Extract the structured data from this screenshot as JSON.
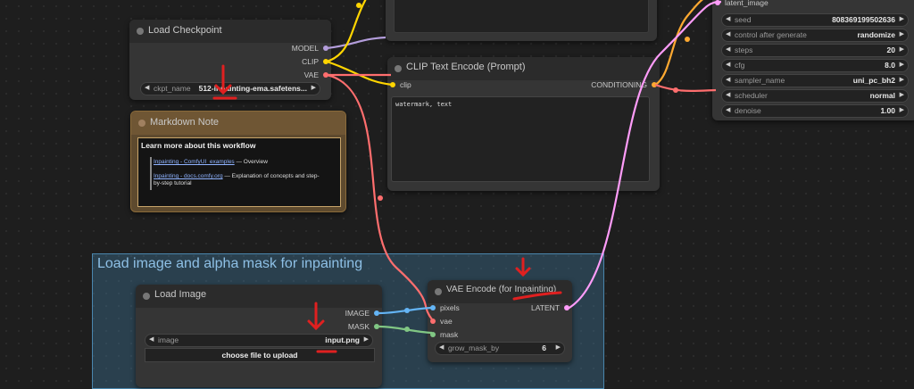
{
  "colors": {
    "model": "#b39ddb",
    "clip": "#ffd500",
    "vae": "#ff6e6e",
    "conditioning": "#ffa931",
    "latent": "#ff9cf9",
    "image": "#64b5f6",
    "mask": "#81c784",
    "accent_red": "#e02020",
    "group_blue": "#3f789e"
  },
  "load_checkpoint": {
    "title": "Load Checkpoint",
    "outputs": [
      "MODEL",
      "CLIP",
      "VAE"
    ],
    "ckpt_label": "ckpt_name",
    "ckpt_value": "512-inpainting-ema.safetens..."
  },
  "markdown_note": {
    "title": "Markdown Note",
    "heading": "Learn more about this workflow",
    "link1": "Inpainting - ComfyUI_examples",
    "link1_desc": "— Overview",
    "link2": "Inpainting - docs.comfy.org",
    "link2_desc": "— Explanation of concepts and step-by-step tutorial"
  },
  "clip_text_encode": {
    "title": "CLIP Text Encode (Prompt)",
    "input": "clip",
    "output": "CONDITIONING",
    "text": "watermark, text"
  },
  "ksampler": {
    "top_input": "latent_image",
    "widgets": [
      {
        "label": "seed",
        "value": "808369199502636"
      },
      {
        "label": "control after generate",
        "value": "randomize"
      },
      {
        "label": "steps",
        "value": "20"
      },
      {
        "label": "cfg",
        "value": "8.0"
      },
      {
        "label": "sampler_name",
        "value": "uni_pc_bh2"
      },
      {
        "label": "scheduler",
        "value": "normal"
      },
      {
        "label": "denoise",
        "value": "1.00"
      }
    ]
  },
  "group": {
    "title": "Load image and alpha mask for inpainting"
  },
  "load_image": {
    "title": "Load Image",
    "outputs": [
      "IMAGE",
      "MASK"
    ],
    "image_label": "image",
    "image_value": "input.png",
    "upload_label": "choose file to upload"
  },
  "vae_encode": {
    "title": "VAE Encode (for Inpainting)",
    "inputs": [
      "pixels",
      "vae",
      "mask"
    ],
    "output": "LATENT",
    "widget_label": "grow_mask_by",
    "widget_value": "6"
  }
}
